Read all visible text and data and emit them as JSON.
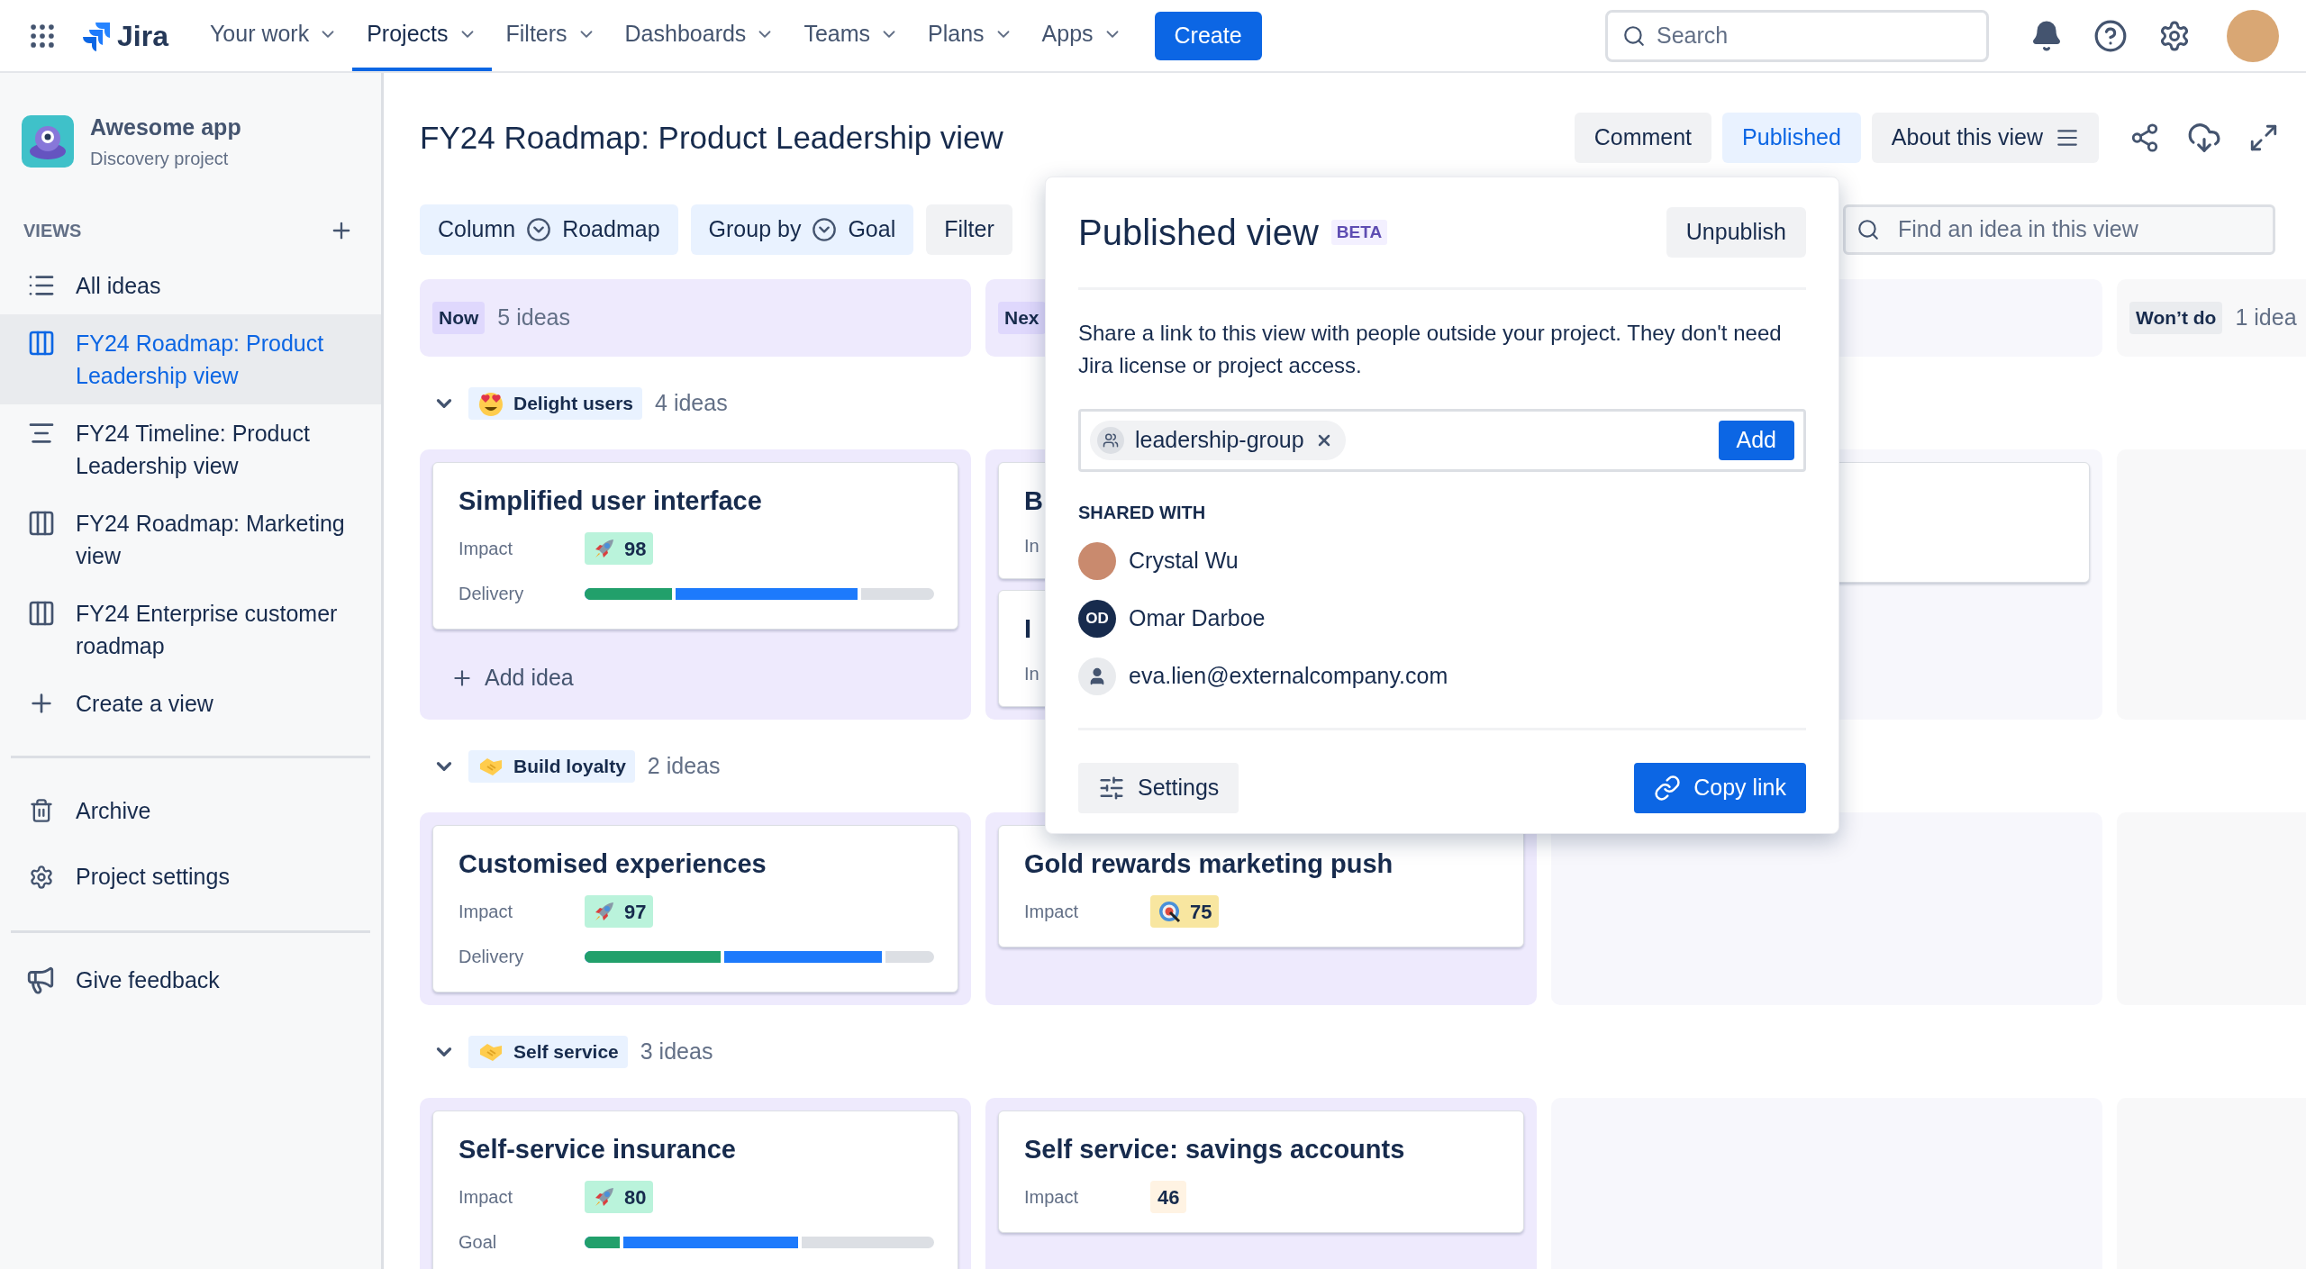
{
  "nav": {
    "brand": "Jira",
    "items": [
      {
        "label": "Your work",
        "selected": false
      },
      {
        "label": "Projects",
        "selected": true
      },
      {
        "label": "Filters",
        "selected": false
      },
      {
        "label": "Dashboards",
        "selected": false
      },
      {
        "label": "Teams",
        "selected": false
      },
      {
        "label": "Plans",
        "selected": false
      },
      {
        "label": "Apps",
        "selected": false
      }
    ],
    "create": "Create",
    "search": {
      "placeholder": "Search"
    }
  },
  "sidebar": {
    "project": {
      "name": "Awesome app",
      "type": "Discovery project"
    },
    "section": "VIEWS",
    "views": [
      {
        "label": "All ideas",
        "kind": "list",
        "selected": false
      },
      {
        "label": "FY24 Roadmap: Product Leadership view",
        "kind": "board",
        "selected": true
      },
      {
        "label": "FY24 Timeline: Product Leadership view",
        "kind": "timeline",
        "selected": false
      },
      {
        "label": "FY24 Roadmap: Marketing view",
        "kind": "board",
        "selected": false
      },
      {
        "label": "FY24 Enterprise customer roadmap",
        "kind": "board",
        "selected": false
      },
      {
        "label": "Create a view",
        "kind": "create",
        "selected": false
      }
    ],
    "links": [
      {
        "label": "Archive",
        "kind": "archive"
      },
      {
        "label": "Project settings",
        "kind": "settings"
      }
    ],
    "feedback": "Give feedback"
  },
  "header": {
    "title": "FY24 Roadmap: Product Leadership view",
    "actions": [
      {
        "label": "Comment",
        "selected": false
      },
      {
        "label": "Published",
        "selected": true
      },
      {
        "label": "About this view",
        "selected": false
      }
    ]
  },
  "toolbar": {
    "filters": [
      {
        "label": "Column",
        "value": "Roadmap"
      },
      {
        "label": "Group by",
        "value": "Goal"
      },
      {
        "label": "Filter"
      }
    ],
    "search": {
      "placeholder": "Find an idea in this view"
    }
  },
  "board": {
    "columns": [
      {
        "label": "Now",
        "count": "5 ideas",
        "color": "#eeeafd",
        "kind": "highlight"
      },
      {
        "label": "Nex",
        "color": "#eeeafd",
        "kind": "highlight"
      },
      {
        "color": "#f7f7fc"
      },
      {
        "label": "Won’t do",
        "count": "1 idea",
        "color": "#f8f8f9",
        "kind": "neutral"
      }
    ],
    "groups": [
      {
        "label": "Delight users",
        "count": "4 ideas",
        "kind": "love",
        "expanded": true,
        "add": "Add idea",
        "cells": [
          {
            "cards": [
              {
                "title": "Simplified user interface",
                "fields": [
                  {
                    "kind": "score-high",
                    "label": "Impact",
                    "value": "98",
                    "color": "#baf3db"
                  },
                  {
                    "kind": "progress",
                    "label": "Delivery",
                    "segments": [
                      {
                        "color": "#22a06b",
                        "level": 0.26
                      },
                      {
                        "color": "#1d7afc",
                        "level": 0.79
                      }
                    ]
                  }
                ]
              }
            ]
          },
          {
            "cards": [
              {
                "title": "B",
                "fields": [
                  {
                    "kind": "cut",
                    "label": "In"
                  }
                ]
              },
              {
                "title": "I",
                "fields": [
                  {
                    "kind": "cut",
                    "label": "In"
                  }
                ]
              }
            ]
          },
          {
            "cards": [
              {
                "kind": "blank"
              }
            ]
          },
          {}
        ]
      },
      {
        "label": "Build loyalty",
        "count": "2 ideas",
        "kind": "deal",
        "expanded": true,
        "cells": [
          {
            "cards": [
              {
                "title": "Customised experiences",
                "fields": [
                  {
                    "kind": "score-high",
                    "label": "Impact",
                    "value": "97",
                    "color": "#baf3db"
                  },
                  {
                    "kind": "progress",
                    "label": "Delivery",
                    "segments": [
                      {
                        "color": "#22a06b",
                        "level": 0.4
                      },
                      {
                        "color": "#1d7afc",
                        "level": 0.86
                      }
                    ]
                  }
                ]
              }
            ]
          },
          {
            "cards": [
              {
                "title": "Gold rewards marketing push",
                "fields": [
                  {
                    "kind": "score-medium",
                    "label": "Impact",
                    "value": "75",
                    "color": "#f8e6a0"
                  }
                ]
              }
            ]
          },
          {},
          {}
        ]
      },
      {
        "label": "Self service",
        "count": "3 ideas",
        "kind": "deal",
        "expanded": true,
        "cells": [
          {
            "cards": [
              {
                "title": "Self-service insurance",
                "fields": [
                  {
                    "kind": "score-high",
                    "label": "Impact",
                    "value": "80",
                    "color": "#baf3db"
                  },
                  {
                    "kind": "progress",
                    "label": "Goal",
                    "segments": [
                      {
                        "color": "#22a06b",
                        "level": 0.11
                      },
                      {
                        "color": "#1d7afc",
                        "level": 0.62
                      }
                    ]
                  }
                ]
              }
            ]
          },
          {
            "cards": [
              {
                "title": "Self service: savings accounts",
                "fields": [
                  {
                    "kind": "score-low",
                    "label": "Impact",
                    "value": "46",
                    "color": "#fff3e3"
                  }
                ]
              }
            ]
          },
          {},
          {}
        ]
      }
    ]
  },
  "popover": {
    "title": "Published view",
    "badge": "BETA",
    "action": "Unpublish",
    "description": "Share a link to this view with people outside your project. They don't need Jira license or project access.",
    "invite": {
      "chips": [
        {
          "label": "leadership-group"
        }
      ],
      "button": "Add"
    },
    "shared_heading": "SHARED WITH",
    "people": [
      {
        "name": "Crystal Wu",
        "kind": "photo"
      },
      {
        "name": "Omar Darboe",
        "kind": "initials",
        "initials": "OD"
      },
      {
        "name": "eva.lien@externalcompany.com",
        "kind": "guest"
      }
    ],
    "settings": "Settings",
    "copy": "Copy link"
  }
}
